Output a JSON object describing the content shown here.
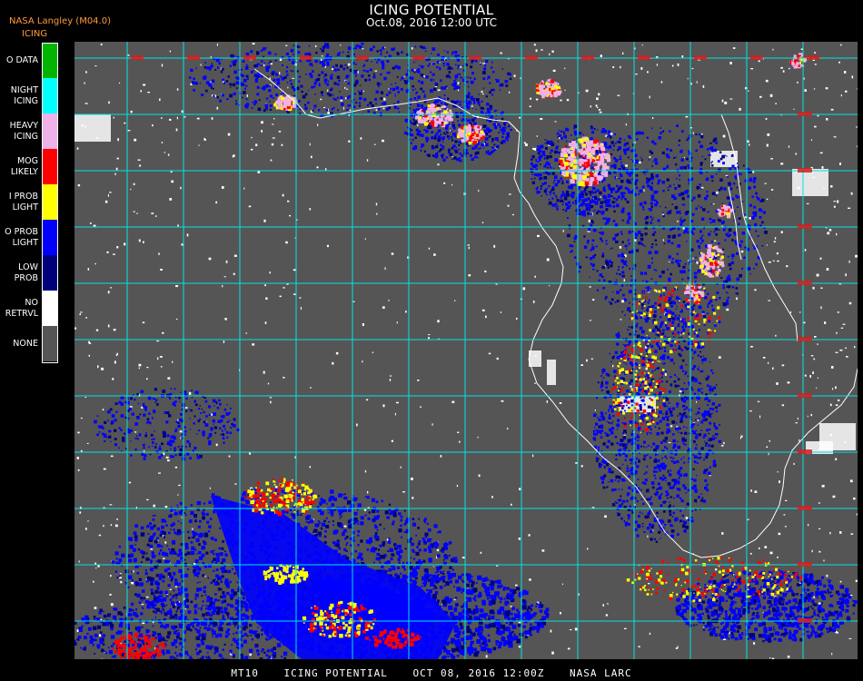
{
  "header": {
    "title": "ICING POTENTIAL",
    "subtitle": "Oct.08, 2016 12:00 UTC",
    "producer": "NASA Langley (M04.0)",
    "legend_title": "ICING"
  },
  "legend": [
    {
      "label": "O DATA",
      "color": "#00b400",
      "icon": "no-data-swatch"
    },
    {
      "label": "NIGHT\nICING",
      "color": "#00ffff",
      "icon": "night-icing-swatch"
    },
    {
      "label": "HEAVY\nICING",
      "color": "#f0b0e8",
      "icon": "heavy-icing-swatch"
    },
    {
      "label": "MOG\nLIKELY",
      "color": "#ff0000",
      "icon": "mog-likely-swatch"
    },
    {
      "label": "I PROB\nLIGHT",
      "color": "#ffff00",
      "icon": "hi-prob-light-swatch"
    },
    {
      "label": "O PROB\nLIGHT",
      "color": "#0000ff",
      "icon": "lo-prob-light-swatch"
    },
    {
      "label": "LOW\nPROB",
      "color": "#00007a",
      "icon": "low-prob-swatch"
    },
    {
      "label": "NO\nRETRVL",
      "color": "#ffffff",
      "icon": "no-retrieval-swatch"
    },
    {
      "label": "NONE",
      "color": "#555555",
      "icon": "none-swatch"
    }
  ],
  "map": {
    "background_color": "#555555",
    "grid_color": "#00e5e5",
    "grid_label_color": "#d22020",
    "coast_color": "#ffffff"
  },
  "footer": {
    "product": "MT10",
    "name": "ICING POTENTIAL",
    "datetime": "OCT 08, 2016 12:00Z",
    "agency": "NASA LARC"
  }
}
